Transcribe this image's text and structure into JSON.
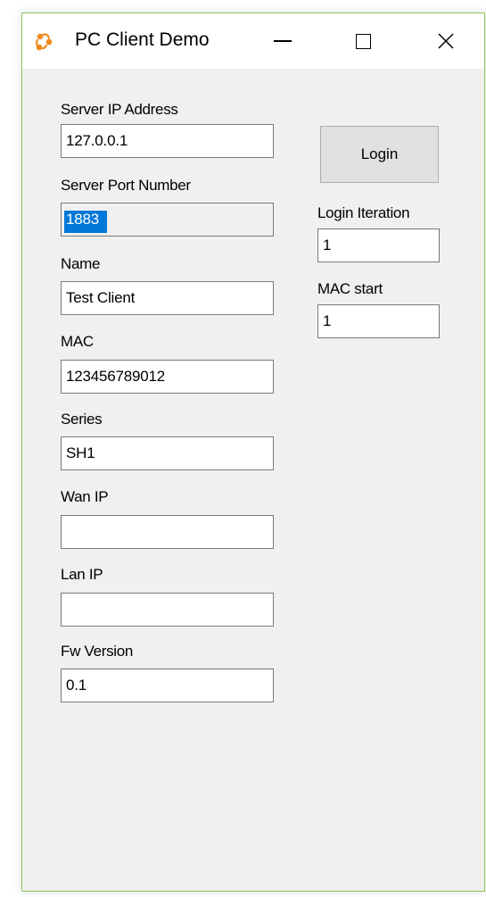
{
  "window": {
    "title": "PC Client Demo",
    "icon": "app-logo-icon",
    "accent_border": "#8fc85a",
    "caption_buttons": [
      "minimize-icon",
      "maximize-icon",
      "close-icon"
    ]
  },
  "form": {
    "server_ip": {
      "label": "Server IP Address",
      "value": "127.0.0.1"
    },
    "server_port": {
      "label": "Server Port Number",
      "value": "1883",
      "selected": true
    },
    "name": {
      "label": "Name",
      "value": "Test Client"
    },
    "mac": {
      "label": "MAC",
      "value": "123456789012"
    },
    "series": {
      "label": "Series",
      "value": "SH1"
    },
    "wan_ip": {
      "label": "Wan IP",
      "value": ""
    },
    "lan_ip": {
      "label": "Lan IP",
      "value": ""
    },
    "fw_version": {
      "label": "Fw Version",
      "value": "0.1"
    }
  },
  "side": {
    "login_button": "Login",
    "login_iteration": {
      "label": "Login Iteration",
      "value": "1"
    },
    "mac_start": {
      "label": "MAC start",
      "value": "1"
    }
  },
  "colors": {
    "selection": "#0078d7",
    "button_face": "#e1e1e1",
    "window_bg": "#f0f0f0"
  }
}
